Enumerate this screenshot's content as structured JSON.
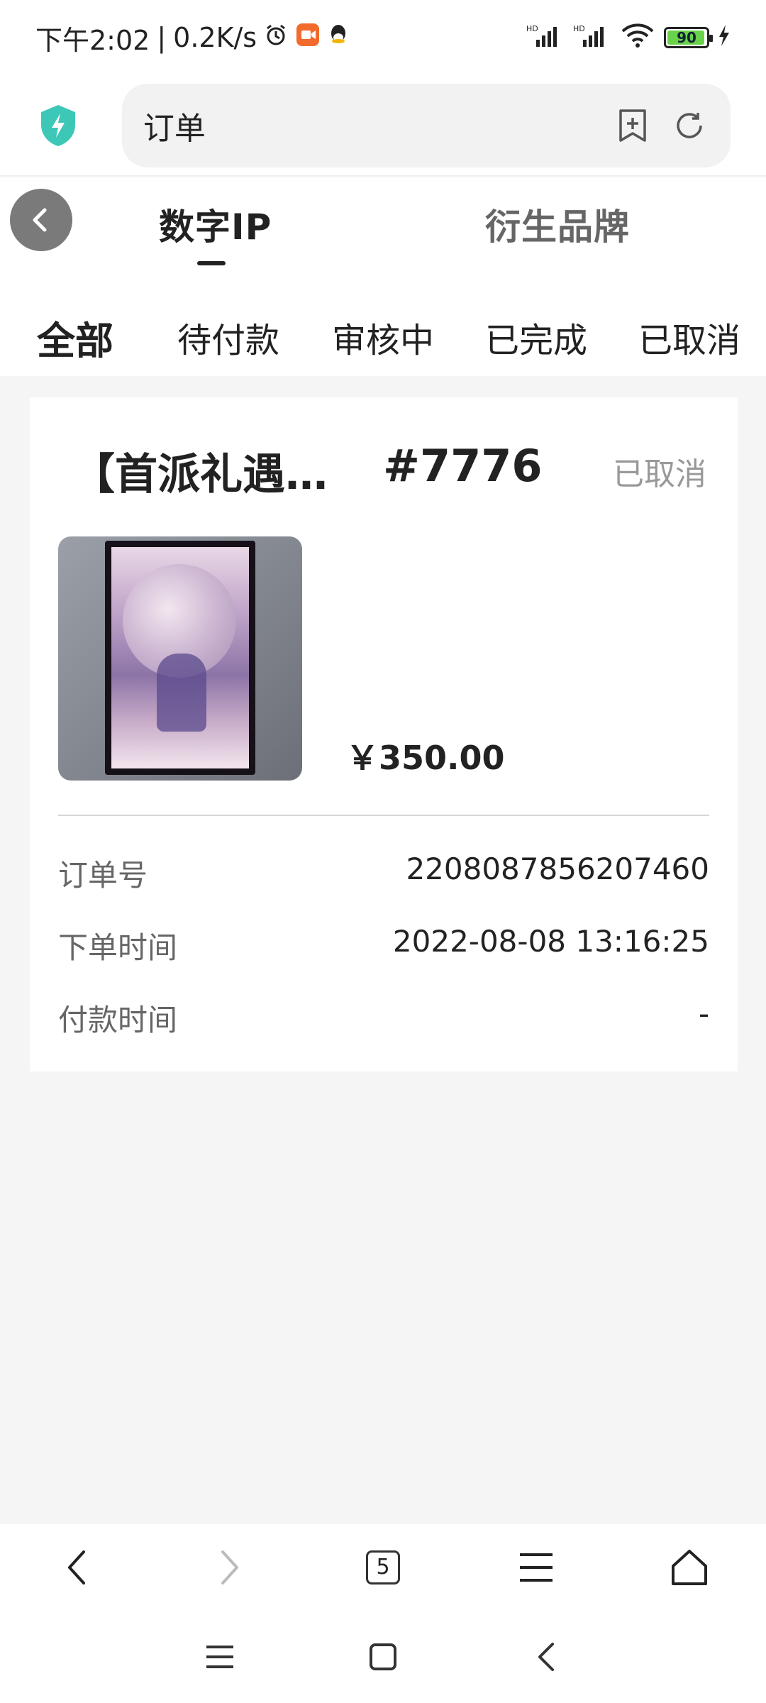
{
  "status_bar": {
    "time": "下午2:02",
    "separator": "|",
    "speed": "0.2K/s",
    "battery_level": "90"
  },
  "browser": {
    "address_text": "订单"
  },
  "top_tabs": [
    {
      "label": "数字IP"
    },
    {
      "label": "衍生品牌"
    }
  ],
  "filters": [
    {
      "label": "全部"
    },
    {
      "label": "待付款"
    },
    {
      "label": "审核中"
    },
    {
      "label": "已完成"
    },
    {
      "label": "已取消"
    }
  ],
  "order": {
    "title": "【首派礼遇…",
    "number": "#7776",
    "status": "已取消",
    "price": "￥350.00",
    "details": [
      {
        "label": "订单号",
        "value": "2208087856207460"
      },
      {
        "label": "下单时间",
        "value": "2022-08-08 13:16:25"
      },
      {
        "label": "付款时间",
        "value": "-"
      }
    ]
  },
  "bottom_toolbar": {
    "tab_count": "5"
  },
  "colors": {
    "accent": "#222222",
    "muted": "#999999",
    "shield": "#3cc7b6",
    "battery_fill": "#6ad24a"
  }
}
